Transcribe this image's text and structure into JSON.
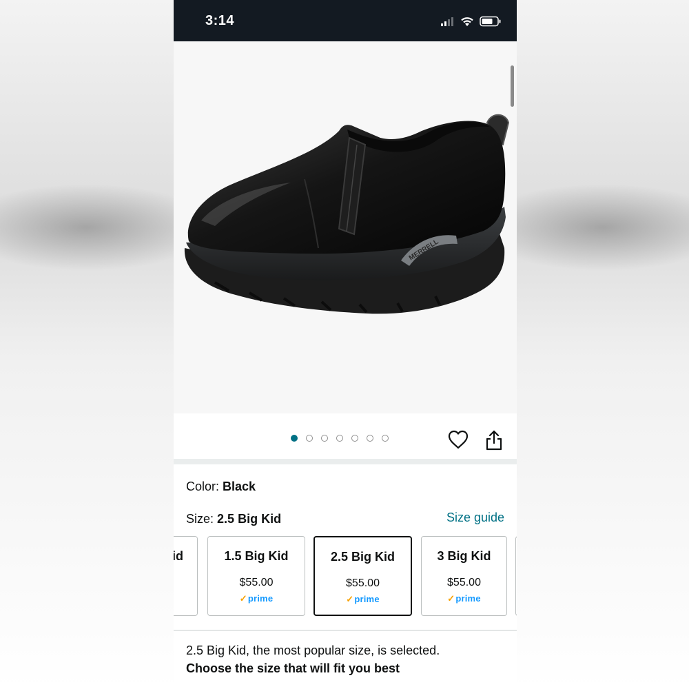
{
  "status_bar": {
    "time": "3:14"
  },
  "product": {
    "image_icon": "merrell-black-leather-slip-on-shoe",
    "brand_mark": "MERRELL"
  },
  "carousel": {
    "dot_count": 7,
    "active_index": 0,
    "favorite_icon": "heart-icon",
    "share_icon": "share-icon"
  },
  "color": {
    "label": "Color:",
    "value": "Black"
  },
  "size": {
    "label": "Size:",
    "value": "2.5 Big Kid",
    "guide_link": "Size guide",
    "partial_left_label": "id",
    "options": [
      {
        "label": "1.5 Big Kid",
        "price": "$55.00",
        "prime": "prime",
        "selected": false
      },
      {
        "label": "2.5 Big Kid",
        "price": "$55.00",
        "prime": "prime",
        "selected": true
      },
      {
        "label": "3 Big Kid",
        "price": "$55.00",
        "prime": "prime",
        "selected": false
      }
    ]
  },
  "notes": {
    "selected_note": "2.5 Big Kid, the most popular size, is selected.",
    "fit_note": "Choose the size that will fit you best"
  },
  "colors": {
    "status_bar_bg": "#131a22",
    "link": "#007185",
    "active_dot": "#007185",
    "prime_blue": "#1399ff",
    "prime_check": "#f7a100"
  }
}
